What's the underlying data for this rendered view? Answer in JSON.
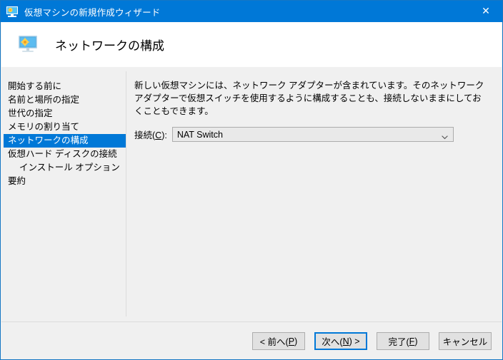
{
  "window": {
    "title": "仮想マシンの新規作成ウィザード",
    "title_icon": "virtual-machine-monitor-icon",
    "close_label": "✕",
    "accent_color": "#0078d7",
    "border_color": "#1577c4",
    "body_background": "#f0f0f0"
  },
  "header": {
    "icon": "network-configuration-monitor-icon",
    "title": "ネットワークの構成"
  },
  "sidebar": {
    "items": [
      {
        "label": "開始する前に",
        "selected": false,
        "indented": false
      },
      {
        "label": "名前と場所の指定",
        "selected": false,
        "indented": false
      },
      {
        "label": "世代の指定",
        "selected": false,
        "indented": false
      },
      {
        "label": "メモリの割り当て",
        "selected": false,
        "indented": false
      },
      {
        "label": "ネットワークの構成",
        "selected": true,
        "indented": false
      },
      {
        "label": "仮想ハード ディスクの接続",
        "selected": false,
        "indented": false
      },
      {
        "label": "インストール オプション",
        "selected": false,
        "indented": true
      },
      {
        "label": "要約",
        "selected": false,
        "indented": false
      }
    ],
    "selected_background": "#0078d7",
    "selected_text_color": "#ffffff"
  },
  "content": {
    "description": "新しい仮想マシンには、ネットワーク アダプターが含まれています。そのネットワーク アダプターで仮想スイッチを使用するように構成することも、接続しないままにしておくこともできます。",
    "connection_field": {
      "label_prefix": "接続(",
      "label_accesskey": "C",
      "label_suffix": "):",
      "value": "NAT Switch",
      "arrow_icon": "chevron-down-icon"
    }
  },
  "footer": {
    "buttons": [
      {
        "prefix": "< 前へ(",
        "accesskey": "P",
        "suffix": ")",
        "focused": false,
        "name": "back-button"
      },
      {
        "prefix": "次へ(",
        "accesskey": "N",
        "suffix": ") >",
        "focused": true,
        "name": "next-button"
      },
      {
        "prefix": "完了(",
        "accesskey": "F",
        "suffix": ")",
        "focused": false,
        "name": "finish-button"
      },
      {
        "prefix": "キャンセル",
        "accesskey": "",
        "suffix": "",
        "focused": false,
        "name": "cancel-button"
      }
    ]
  }
}
